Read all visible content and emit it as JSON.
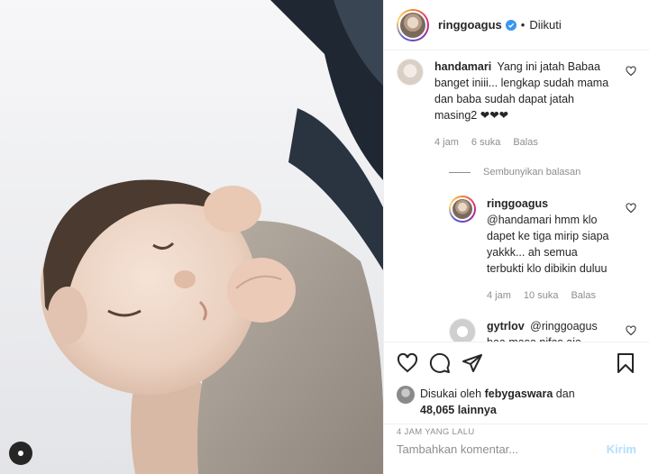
{
  "post": {
    "image_alt": "newborn baby photo",
    "menu_icon": "more-options-icon"
  },
  "header": {
    "username": "ringgoagus",
    "verified_icon": "verified-badge-icon",
    "separator": "•",
    "follow_status": "Diikuti"
  },
  "comments": [
    {
      "username": "handamari",
      "text": "Yang ini jatah Babaa banget iniii... lengkap sudah mama dan baba sudah dapat jatah masing2 ❤❤❤",
      "time": "4 jam",
      "likes": "6 suka",
      "reply_label": "Balas"
    }
  ],
  "hide_replies_label": "Sembunyikan balasan",
  "replies": [
    {
      "username": "ringgoagus",
      "text": "@handamari hmm klo dapet ke tiga mirip siapa yakkk... ah semua terbukti klo dibikin duluu",
      "time": "4 jam",
      "likes": "10 suka",
      "reply_label": "Balas"
    }
  ],
  "partial_comment": {
    "username": "gytrlov",
    "text": "@ringgoagus baa masa nifas aja belom kelar ba�"
  },
  "actions": {
    "like_icon": "heart-icon",
    "comment_icon": "comment-icon",
    "share_icon": "share-icon",
    "save_icon": "bookmark-icon"
  },
  "likes": {
    "prefix": "Disukai oleh",
    "liker": "febygaswara",
    "conj": "dan",
    "count": "48,065 lainnya"
  },
  "timestamp": "4 JAM YANG LALU",
  "add_comment": {
    "placeholder": "Tambahkan komentar...",
    "post_label": "Kirim"
  },
  "colors": {
    "verified": "#3897f0",
    "muted": "#8e8e8e",
    "post_button": "#b2dffc",
    "text": "#262626"
  }
}
